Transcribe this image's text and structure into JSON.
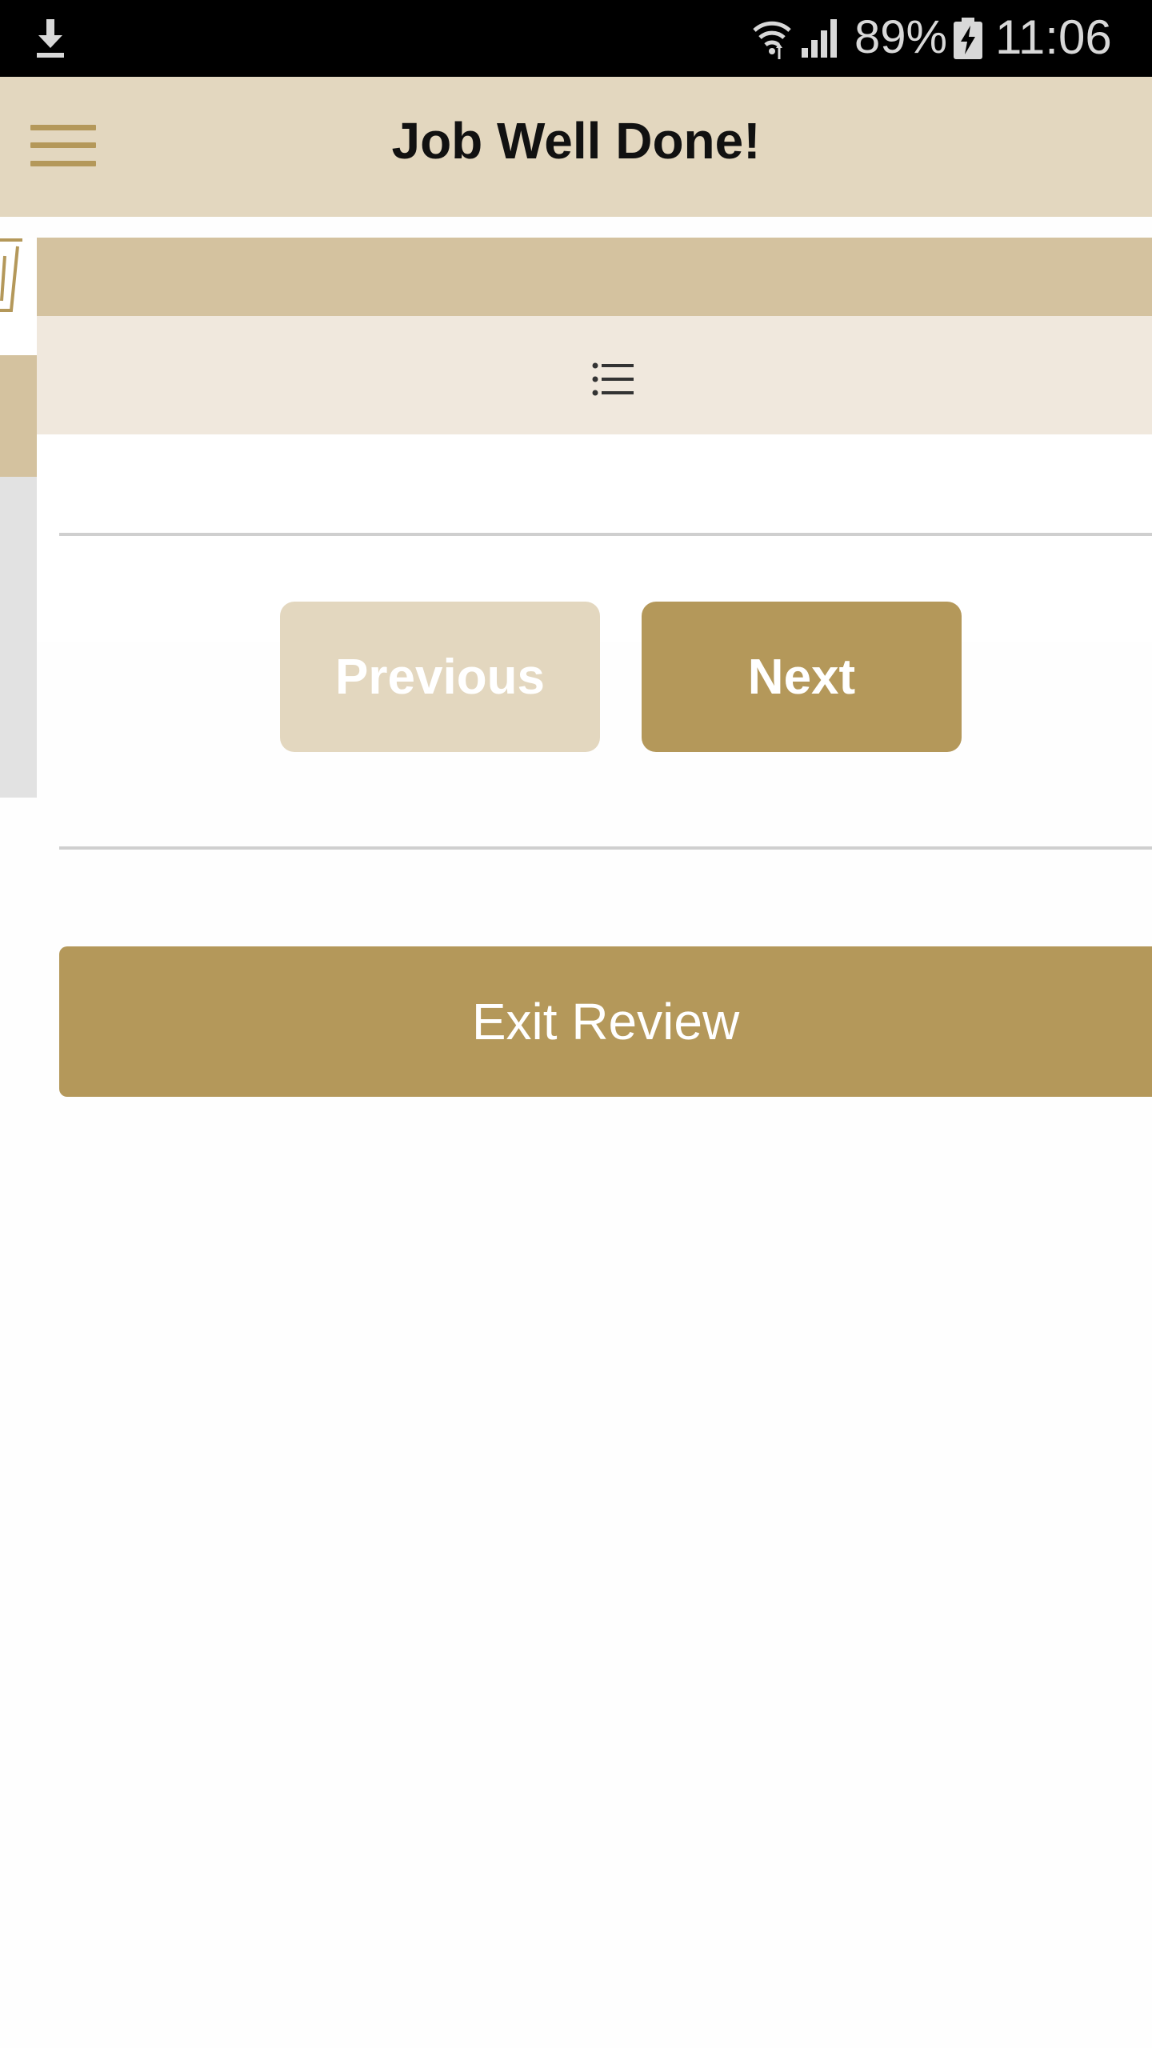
{
  "status_bar": {
    "battery_percent": "89%",
    "time": "11:06",
    "icons": [
      "download-icon",
      "wifi-icon",
      "signal-icon",
      "battery-charging-icon"
    ]
  },
  "app_bar": {
    "title": "Job Well Done!",
    "menu_icon": "hamburger-menu-icon"
  },
  "toolbar": {
    "list_icon": "list-icon"
  },
  "navigation": {
    "previous_label": "Previous",
    "next_label": "Next"
  },
  "exit_label": "Exit Review",
  "colors": {
    "accent": "#b4985a",
    "app_bar_bg": "#e3d7bf",
    "panel_header_bg": "#d4c29f",
    "toolbar_bg": "#f0e8dd",
    "previous_disabled_bg": "#e3d7bf"
  }
}
